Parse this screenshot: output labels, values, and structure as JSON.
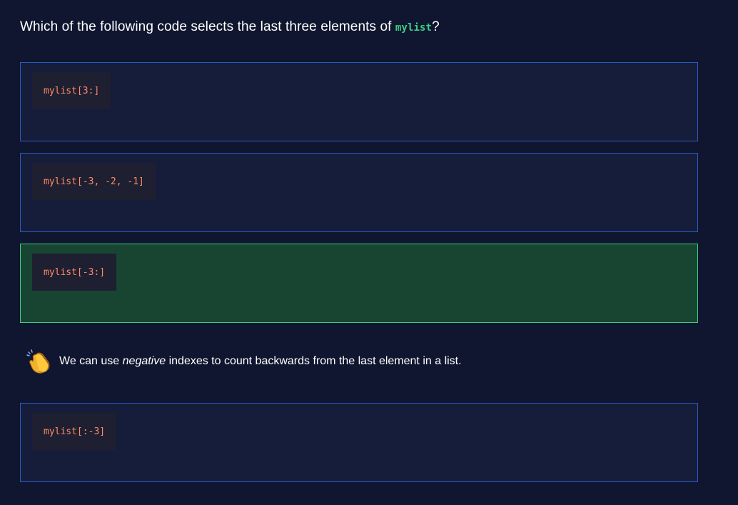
{
  "question": {
    "prefix": "Which of the following code selects the last three elements of ",
    "code": "mylist",
    "suffix": "?"
  },
  "options": [
    {
      "code": "mylist[3:]",
      "state": "default"
    },
    {
      "code": "mylist[-3, -2, -1]",
      "state": "default"
    },
    {
      "code": "mylist[-3:]",
      "state": "correct"
    },
    {
      "code": "mylist[:-3]",
      "state": "default"
    }
  ],
  "feedback": {
    "icon": "clapping-hands-icon",
    "before": "We can use ",
    "emphasis": "negative",
    "after": " indexes to count backwards from the last element in a list."
  },
  "colors": {
    "background": "#10162f",
    "option_border": "#2b59c3",
    "correct_bg": "#184531",
    "correct_border": "#3ccd87",
    "code_text": "#ff8a6b",
    "inline_code": "#3ccd87"
  }
}
